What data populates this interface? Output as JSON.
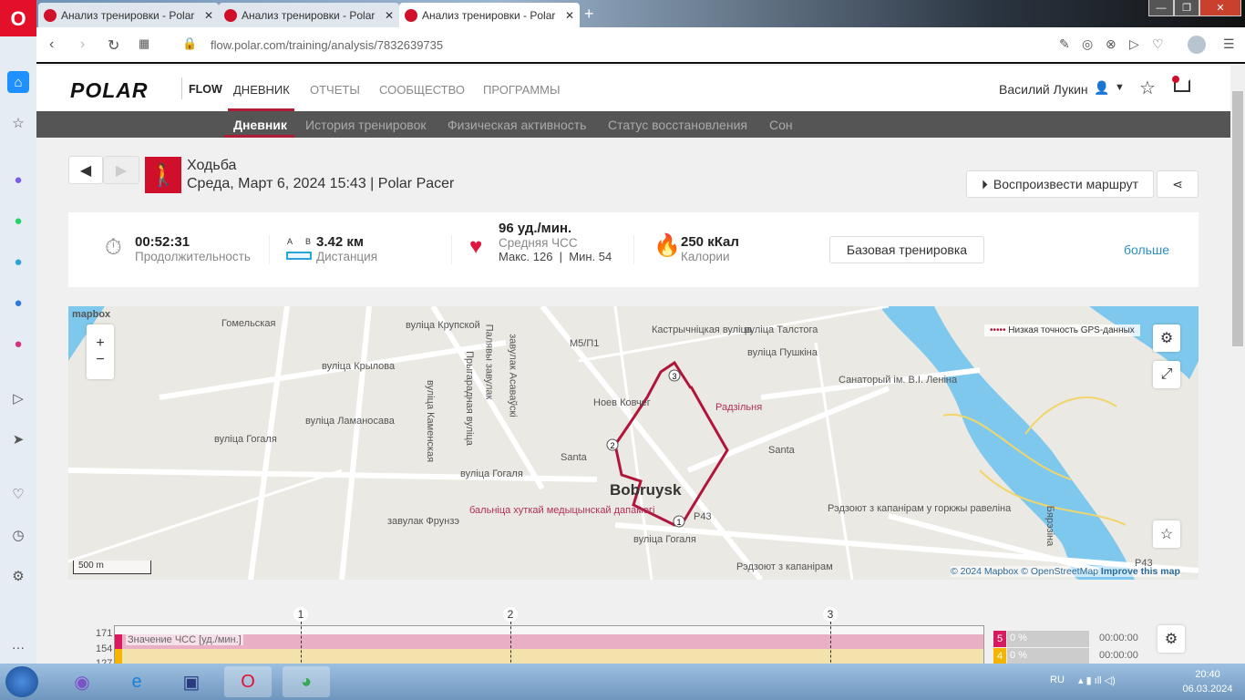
{
  "browser": {
    "tabs": [
      {
        "title": "Анализ тренировки - Polar"
      },
      {
        "title": "Анализ тренировки - Polar"
      },
      {
        "title": "Анализ тренировки - Polar"
      }
    ],
    "url": "flow.polar.com/training/analysis/7832639735"
  },
  "header": {
    "logo": "POLAR",
    "flow": "FLOW",
    "nav": [
      "ДНЕВНИК",
      "ОТЧЕТЫ",
      "СООБЩЕСТВО",
      "ПРОГРАММЫ"
    ],
    "user": "Василий Лукин"
  },
  "subnav": [
    "Дневник",
    "История тренировок",
    "Физическая активность",
    "Статус восстановления",
    "Сон"
  ],
  "activity": {
    "sport": "Ходьба",
    "subtitle": "Среда, Март 6, 2024 15:43 | Polar Pacer",
    "replay": "Воспроизвести маршрут"
  },
  "stats": {
    "duration": "00:52:31",
    "duration_label": "Продолжительность",
    "dist_a": "A",
    "dist_b": "B",
    "distance": "3.42 км",
    "distance_label": "Дистанция",
    "hr": "96 уд./мин.",
    "hr_label": "Средняя ЧСС",
    "hr_minmax": "Макс. 126  |  Мин. 54",
    "calories": "250 кКал",
    "calories_label": "Калории",
    "target": "Базовая тренировка",
    "more": "больше"
  },
  "map": {
    "brand": "mapbox",
    "legend": "Низкая точность GPS-данных",
    "scale": "500 m",
    "attr_mapbox": "© 2024 Mapbox",
    "attr_osm": "© OpenStreetMap",
    "improve": "Improve this map",
    "labels": [
      "Гомельская",
      "вуліца Крупской",
      "вуліца Крылова",
      "вуліца Ламаносава",
      "вуліца Каменская",
      "Прыгарадная вуліца",
      "Палявы завулак",
      "завулак Асаваўскі",
      "вуліца Гогаля",
      "вуліца Гогаля",
      "завулак Фрунзэ",
      "бальніца хуткай медыцынскай дапамогі",
      "Bobruysk",
      "Ноев Ковчег",
      "Радзільня",
      "Santa",
      "Santa",
      "вуліца Талстога",
      "вуліца Пушкіна",
      "Санаторый ім. В.І. Леніна",
      "Рэдзоют з капанірам у горкжы равеліна",
      "Рэдзоют з капанірам",
      "Бярэзіна",
      "Кастрычніцкая вуліца",
      "М5/П1",
      "Р43",
      "Р43",
      "вуліца Гогаля"
    ],
    "laps": [
      "1",
      "2",
      "3"
    ]
  },
  "chart": {
    "y_ticks": [
      "171",
      "154",
      "127"
    ],
    "series_label": "Значение ЧСС [уд./мин.]",
    "laps": [
      "1",
      "2",
      "3"
    ],
    "zones": [
      {
        "zone": "5",
        "pct": "0 %",
        "time": "00:00:00",
        "color": "#d81b60"
      },
      {
        "zone": "4",
        "pct": "0 %",
        "time": "00:00:00",
        "color": "#f5b400"
      }
    ]
  },
  "taskbar": {
    "lang": "RU",
    "time": "20:40",
    "date": "06.03.2024"
  }
}
